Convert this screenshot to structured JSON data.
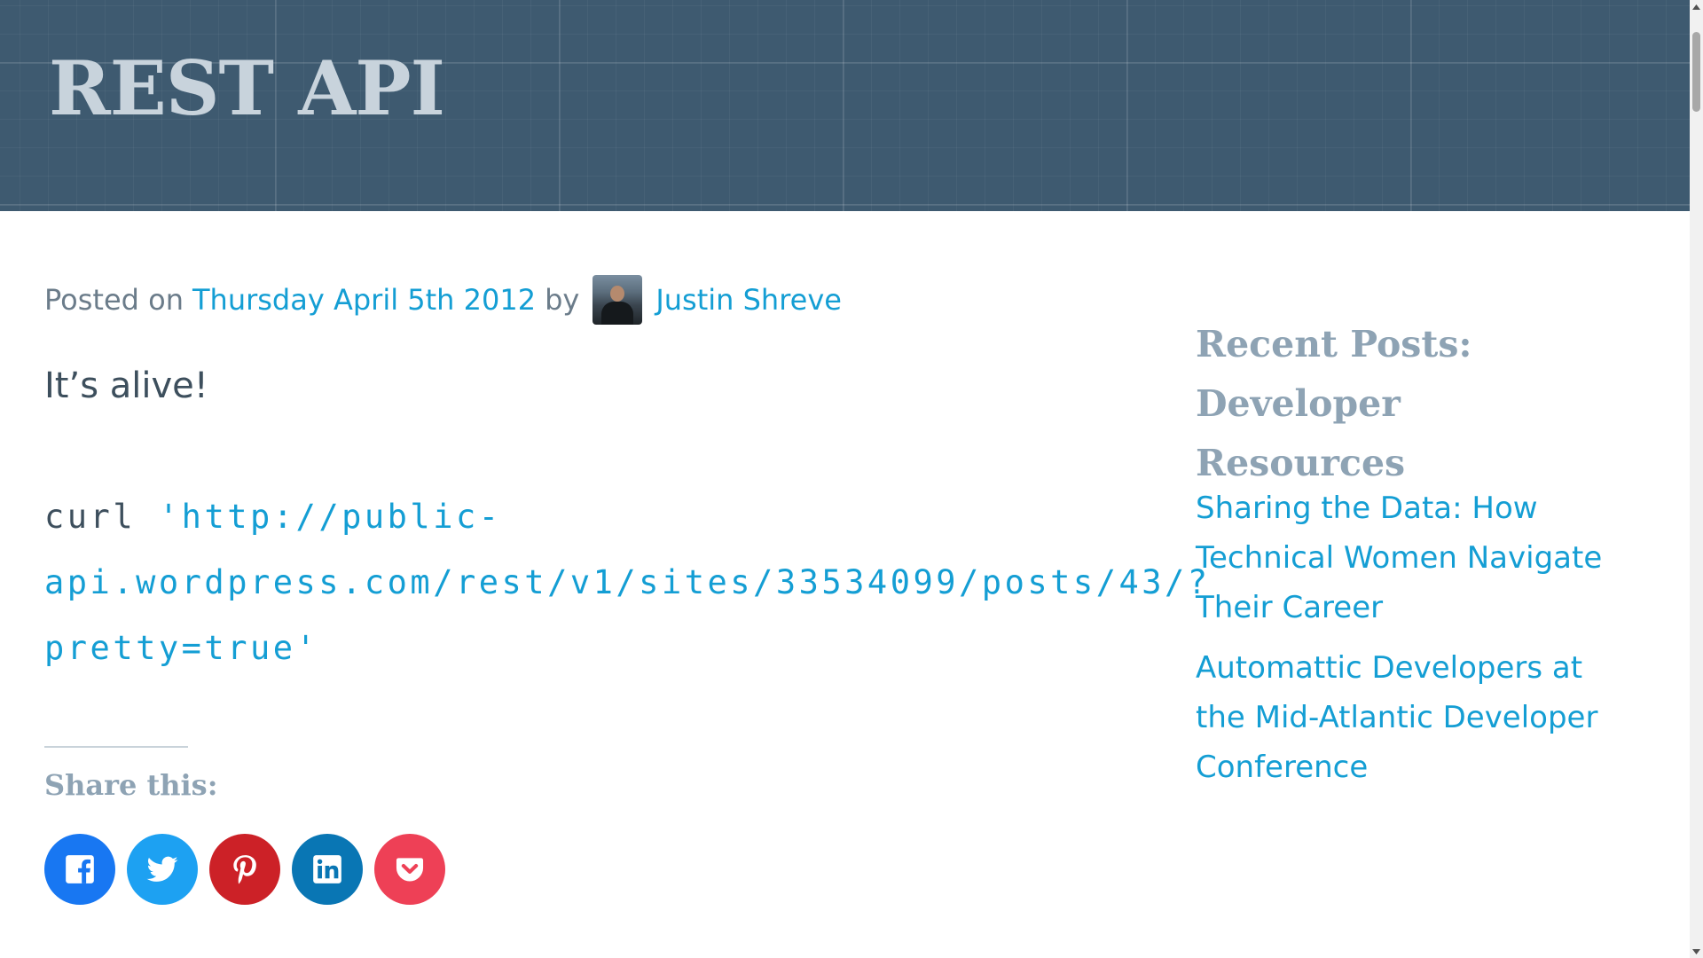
{
  "header": {
    "title": "REST API"
  },
  "meta": {
    "posted_prefix": "Posted on",
    "date": "Thursday April 5th 2012",
    "by": "by",
    "author": "Justin Shreve"
  },
  "content": {
    "intro": "It’s alive!",
    "code_command": "curl ",
    "code_url": "'http://public-api.wordpress.com/rest/v1/sites/33534099/posts/43/?pretty=true'"
  },
  "share": {
    "heading": "Share this:",
    "buttons": [
      {
        "label": "Facebook",
        "color": "#1877f2",
        "icon": "facebook-icon"
      },
      {
        "label": "Twitter",
        "color": "#1da1f2",
        "icon": "twitter-icon"
      },
      {
        "label": "Pinterest",
        "color": "#cc2127",
        "icon": "pinterest-icon"
      },
      {
        "label": "LinkedIn",
        "color": "#0976b4",
        "icon": "linkedin-icon"
      },
      {
        "label": "Pocket",
        "color": "#ee4056",
        "icon": "pocket-icon"
      }
    ]
  },
  "sidebar": {
    "title": "Recent Posts: Developer Resources",
    "posts": [
      {
        "title": "Sharing the Data: How Technical Women Navigate Their Career"
      },
      {
        "title": "Automattic Developers at the Mid-Atlantic Developer Conference"
      }
    ]
  },
  "colors": {
    "header_bg": "#3e5a70",
    "link": "#149ed4",
    "heading_muted": "#8ea3b4",
    "body_text": "#3d4f5d"
  }
}
